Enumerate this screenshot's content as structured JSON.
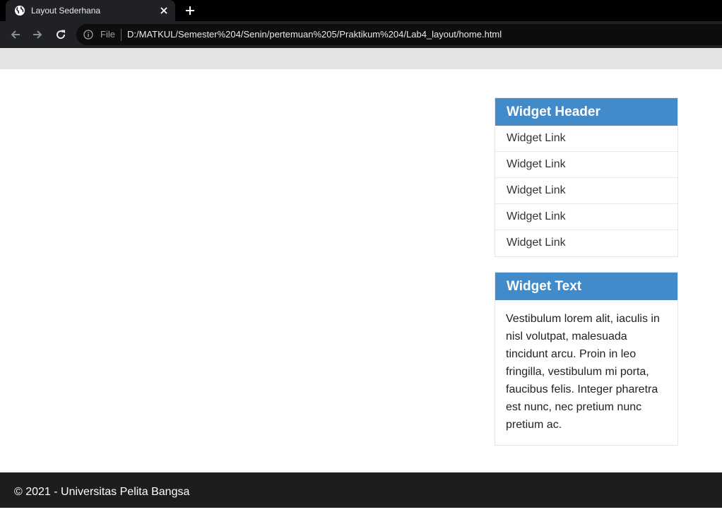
{
  "browser": {
    "tab_title": "Layout Sederhana",
    "omnibox_scheme_label": "File",
    "url": "D:/MATKUL/Semester%204/Senin/pertemuan%205/Praktikum%204/Lab4_layout/home.html",
    "icons": {
      "favicon": "globe-icon",
      "close": "close-icon",
      "new_tab": "plus-icon",
      "back": "arrow-left-icon",
      "forward": "arrow-right-icon",
      "reload": "reload-icon",
      "site_info": "info-icon"
    }
  },
  "sidebar": {
    "link_widget": {
      "header": "Widget Header",
      "links": [
        "Widget Link",
        "Widget Link",
        "Widget Link",
        "Widget Link",
        "Widget Link"
      ]
    },
    "text_widget": {
      "header": "Widget Text",
      "body": "Vestibulum lorem alit, iaculis in nisl volutpat, malesuada tincidunt arcu. Proin in leo fringilla, vestibulum mi porta, faucibus felis. Integer pharetra est nunc, nec pretium nunc pretium ac."
    }
  },
  "footer": {
    "text": "© 2021 - Universitas Pelita Bangsa"
  },
  "colors": {
    "widget_header_bg": "#428bca",
    "footer_bg": "#1d1d1d",
    "topbar_bg": "#e3e3e3"
  }
}
